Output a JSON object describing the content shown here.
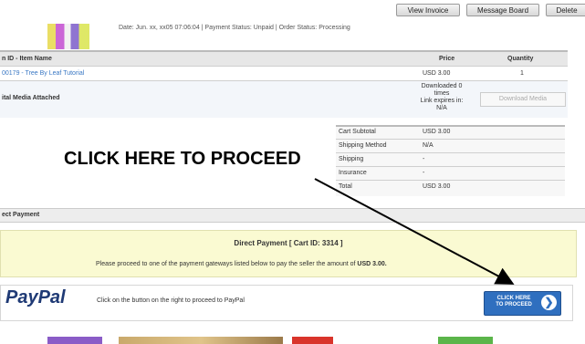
{
  "toolbar": {
    "view_invoice": "View Invoice",
    "message_board": "Message Board",
    "delete": "Delete"
  },
  "order_meta": {
    "text": "Date: Jun. xx, xx05 07:06:04 | Payment Status: Unpaid | Order Status: Processing"
  },
  "items_table": {
    "headers": {
      "item": "n ID - Item Name",
      "price": "Price",
      "quantity": "Quantity"
    },
    "row": {
      "item": "00179 - Tree By Leaf Tutorial",
      "price": "USD 3.00",
      "quantity": "1"
    }
  },
  "digital_media": {
    "title": "ital Media Attached",
    "status_lines": [
      "Downloaded 0",
      "times",
      "Link expires in:",
      "N/A"
    ],
    "download_button": "Download Media"
  },
  "summary": [
    {
      "label": "Cart Subtotal",
      "value": "USD 3.00"
    },
    {
      "label": "Shipping Method",
      "value": "N/A"
    },
    {
      "label": "Shipping",
      "value": "-"
    },
    {
      "label": "Insurance",
      "value": "-"
    },
    {
      "label": "Total",
      "value": "USD 3.00"
    }
  ],
  "annotation": {
    "callout": "CLICK HERE TO PROCEED"
  },
  "direct_payment": {
    "section_title": "ect Payment",
    "box_title": "Direct Payment [ Cart ID: 3314 ]",
    "instruction": "Please proceed to one of the payment gateways listed below to pay the seller the amount of",
    "amount": "USD 3.00"
  },
  "paypal": {
    "logo_text": "PayPal",
    "instruction": "Click on the button on the right to proceed to PayPal",
    "button_line1": "CLICK HERE",
    "button_line2": "TO PROCEED",
    "button_arrow": "❯"
  },
  "colors": {
    "link": "#3a78c4",
    "paypal_dark": "#1f3a75",
    "paypal_light": "#3f8bd6",
    "button_blue": "#2f6fbf",
    "yellow_box": "#fafad2"
  }
}
